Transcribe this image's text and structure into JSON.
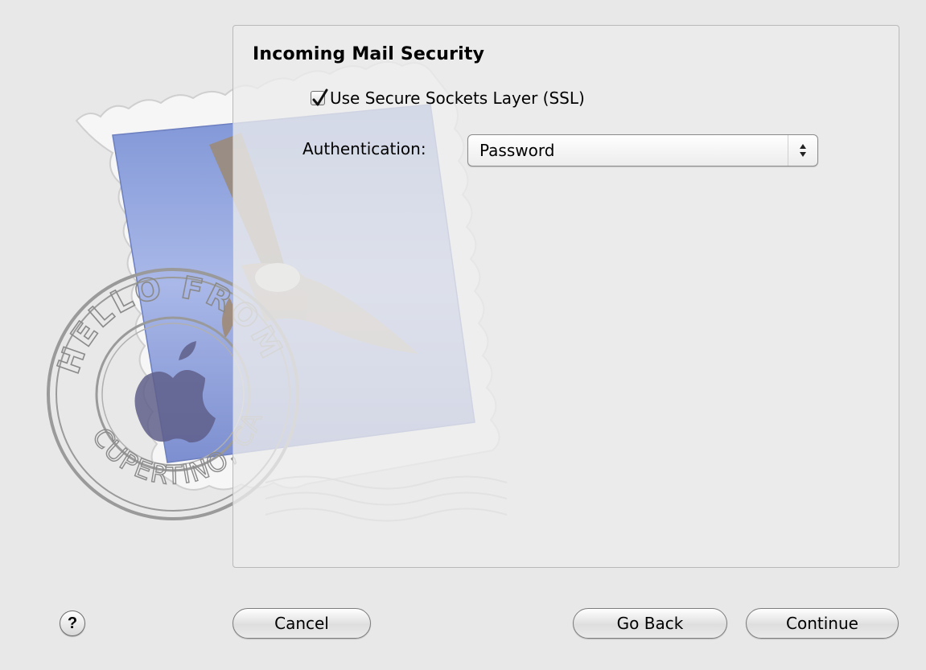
{
  "section": {
    "title": "Incoming Mail Security"
  },
  "ssl": {
    "label": "Use Secure Sockets Layer (SSL)",
    "checked": true
  },
  "authentication": {
    "label": "Authentication:",
    "selected": "Password"
  },
  "buttons": {
    "help": "?",
    "cancel": "Cancel",
    "go_back": "Go Back",
    "continue": "Continue"
  },
  "stamp_text": {
    "top": "HELLO FROM",
    "bottom": "CUPERTINO, CA"
  }
}
